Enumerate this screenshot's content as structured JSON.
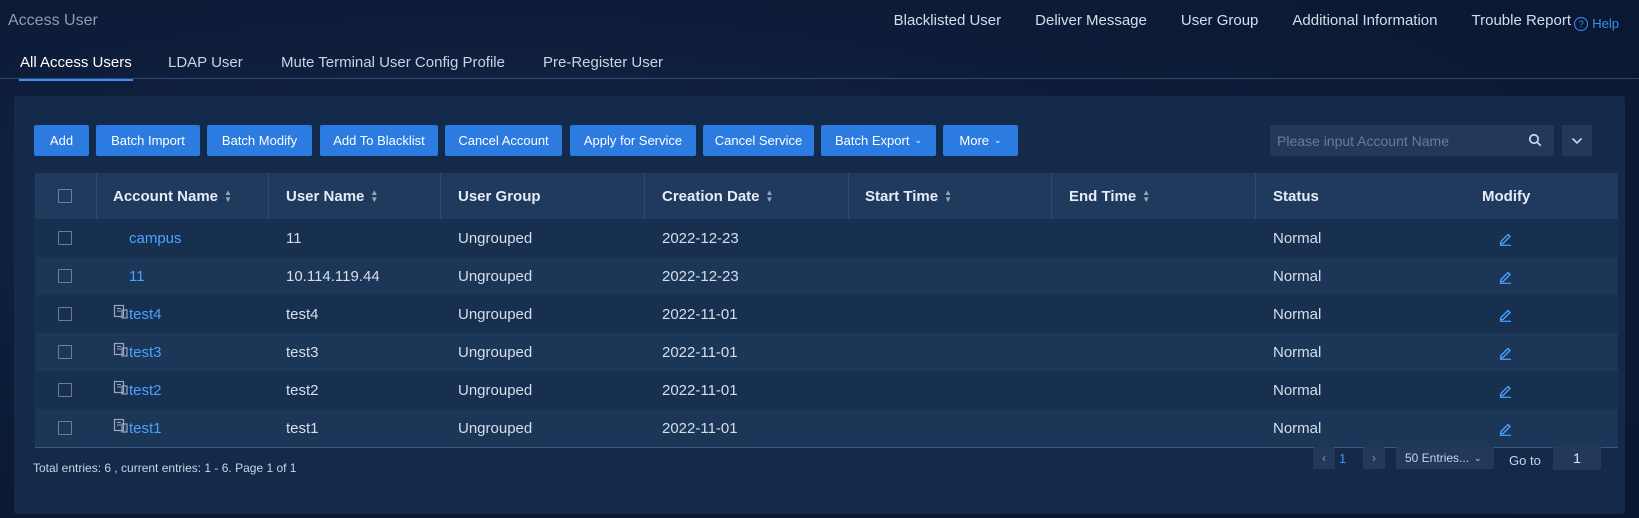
{
  "page_title": "Access User",
  "top_nav": [
    "Blacklisted User",
    "Deliver Message",
    "User Group",
    "Additional Information",
    "Trouble Report"
  ],
  "help_label": "Help",
  "tabs": [
    "All Access Users",
    "LDAP User",
    "Mute Terminal User Config Profile",
    "Pre-Register User"
  ],
  "active_tab": "All Access Users",
  "toolbar": {
    "add": "Add",
    "batch_import": "Batch Import",
    "batch_modify": "Batch Modify",
    "add_to_blacklist": "Add To Blacklist",
    "cancel_account": "Cancel Account",
    "apply_for_service": "Apply for Service",
    "cancel_service": "Cancel Service",
    "batch_export": "Batch Export",
    "more": "More"
  },
  "search": {
    "placeholder": "Please input Account Name",
    "value": ""
  },
  "columns": [
    "Account Name",
    "User Name",
    "User Group",
    "Creation Date",
    "Start Time",
    "End Time",
    "Status",
    "Modify"
  ],
  "rows": [
    {
      "account": "campus",
      "user": "11",
      "group": "Ungrouped",
      "created": "2022-12-23",
      "start": "",
      "end": "",
      "status": "Normal",
      "has_icon": false
    },
    {
      "account": "11",
      "user": "10.114.119.44",
      "group": "Ungrouped",
      "created": "2022-12-23",
      "start": "",
      "end": "",
      "status": "Normal",
      "has_icon": false
    },
    {
      "account": "test4",
      "user": "test4",
      "group": "Ungrouped",
      "created": "2022-11-01",
      "start": "",
      "end": "",
      "status": "Normal",
      "has_icon": true
    },
    {
      "account": "test3",
      "user": "test3",
      "group": "Ungrouped",
      "created": "2022-11-01",
      "start": "",
      "end": "",
      "status": "Normal",
      "has_icon": true
    },
    {
      "account": "test2",
      "user": "test2",
      "group": "Ungrouped",
      "created": "2022-11-01",
      "start": "",
      "end": "",
      "status": "Normal",
      "has_icon": true
    },
    {
      "account": "test1",
      "user": "test1",
      "group": "Ungrouped",
      "created": "2022-11-01",
      "start": "",
      "end": "",
      "status": "Normal",
      "has_icon": true
    }
  ],
  "footer": {
    "summary": "Total entries: 6 , current entries: 1 - 6. Page 1 of 1",
    "current_page": "1",
    "page_size": "50 Entries...",
    "goto_label": "Go to",
    "goto_value": "1"
  },
  "colors": {
    "accent": "#2b7be0",
    "link": "#4aa1ff",
    "panel": "#142a4a"
  }
}
